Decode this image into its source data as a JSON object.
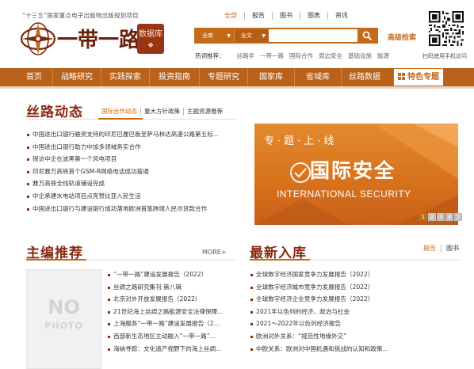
{
  "header": {
    "top_note": "“十三五”国家重点电子出版物出版规划项目",
    "logo_text": "一带一路",
    "logo_seal": "数据库",
    "search_tabs": [
      "全部",
      "报告",
      "图书",
      "图表",
      "资讯"
    ],
    "scope_select": "全库",
    "field_select": "全文",
    "search_value": "",
    "advanced_label": "高级检索",
    "hot_label": "热词推荐：",
    "hot_words": [
      "丝路学",
      "一带一路",
      "国际合作",
      "周边安全",
      "基础设施",
      "能源"
    ],
    "qr_caption": "扫码使用手机访问"
  },
  "nav": {
    "items": [
      "首页",
      "战略研究",
      "实践探索",
      "投资指南",
      "专题研究",
      "国家库",
      "省域库",
      "丝路数据"
    ],
    "special": "特色专题"
  },
  "silk": {
    "title": "丝路动态",
    "tabs": [
      "国际合作动态",
      "重大方针政策",
      "主题资源推荐"
    ],
    "items": [
      "中国进出口银行融资支持的印尼巴厘巴板至萨马林达高速公路第五标...",
      "中国进出口银行助力中加多领域务实合作",
      "探访中企在波黑第一个风电项目",
      "印尼雅万高铁首个GSM-R网络电话成功拨通",
      "雅万高铁全线轨道铺设完成",
      "中企承建水电站项目点亮赞比亚人民生活",
      "中国进出口银行与建设银行成功落地欧洲首笔跨境人民币贷款合作"
    ]
  },
  "banner": {
    "label": "专·题·上·线",
    "title": "国际安全",
    "subtitle": "INTERNATIONAL SECURITY",
    "pages": [
      "1",
      "2",
      "3",
      "4",
      "5"
    ],
    "active_page": 1
  },
  "editor": {
    "title": "主编推荐",
    "more": "MORE+",
    "placeholder_line1": "NO",
    "placeholder_line2": "PHOTO",
    "items": [
      "“一带一路”建设发展报告（2022）",
      "丝绸之路研究集刊·第八辑",
      "北京对外开放发展报告（2022）",
      "21世纪海上丝绸之路能源安全法律保障...",
      "上海服务“一带一路”建设发展报告（2...",
      "西部新生态地区主动融入“一带一路”...",
      "海纳寻踪：文化遗产视野下的海上丝绸..."
    ]
  },
  "latest": {
    "title": "最新入库",
    "tabs": [
      "报告",
      "图书"
    ],
    "items": [
      "全球数字经济国家竞争力发展报告（2022）",
      "全球数字经济城市竞争力发展报告（2022）",
      "全球数字经济企业竞争力发展报告（2022）",
      "2021年以色列的经济、政治与社会",
      "2021～2022年以色列经济报告",
      "欧洲对外关系：“规范性地缘外交”",
      "中欧关系：欧洲对中国机遇和挑战的认知和政策..."
    ]
  },
  "colors": {
    "accent": "#c56a18",
    "nav": "#b8621b",
    "title": "#8a2a10"
  }
}
